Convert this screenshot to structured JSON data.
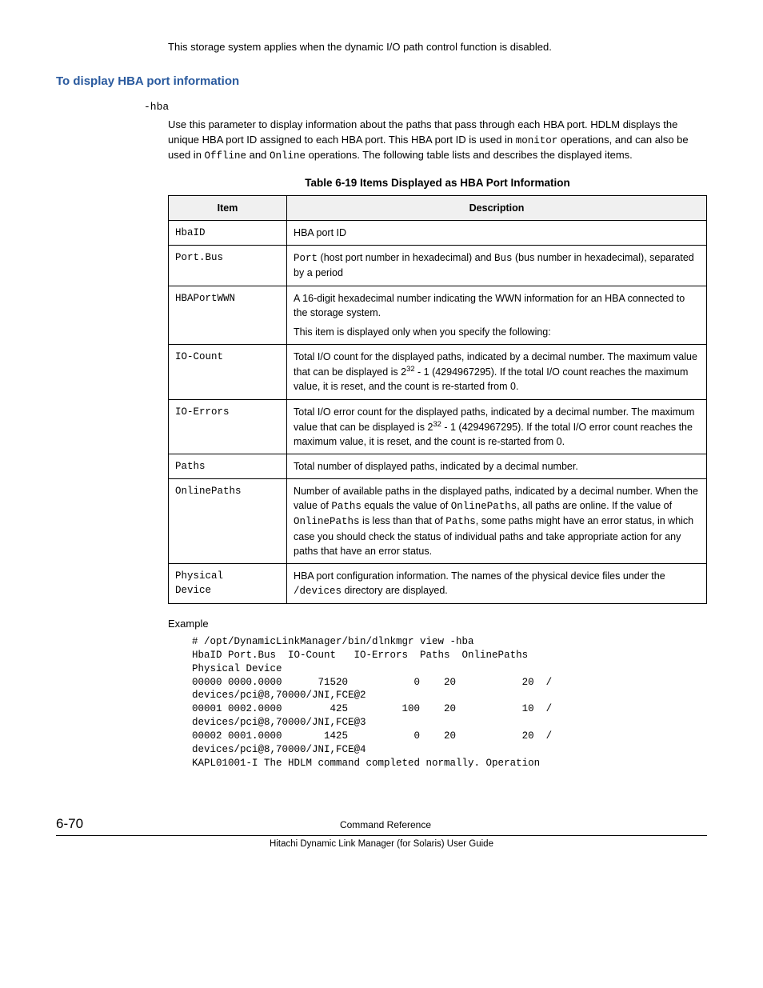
{
  "intro": "This storage system applies when the dynamic I/O path control function is disabled.",
  "heading": "To display HBA port information",
  "param": "-hba",
  "param_desc_1": "Use this parameter to display information about the paths that pass through each HBA port. HDLM displays the unique HBA port ID assigned to each HBA port. This HBA port ID is used in ",
  "param_desc_mono1": "monitor",
  "param_desc_2": " operations, and can also be used in ",
  "param_desc_mono2": "Offline",
  "param_desc_3": " and ",
  "param_desc_mono3": "Online",
  "param_desc_4": " operations. The following table lists and describes the displayed items.",
  "table_caption": "Table 6-19 Items Displayed as HBA Port Information",
  "table_head_item": "Item",
  "table_head_desc": "Description",
  "rows": {
    "r0_item": "HbaID",
    "r0_desc": "HBA port ID",
    "r1_item": "Port.Bus",
    "r1_desc_a": "Port",
    "r1_desc_b": " (host port number in hexadecimal) and ",
    "r1_desc_c": "Bus",
    "r1_desc_d": " (bus number in hexadecimal), separated by a period",
    "r2_item": "HBAPortWWN",
    "r2_desc_a": "A 16-digit hexadecimal number indicating the WWN information for an HBA connected to the storage system.",
    "r2_desc_b": "This item is displayed only when you specify the following:",
    "r3_item": "IO-Count",
    "r3_desc_a": "Total I/O count for the displayed paths, indicated by a decimal number. The maximum value that can be displayed is 2",
    "r3_sup": "32",
    "r3_desc_b": " - 1 (4294967295). If the total I/O count reaches the maximum value, it is reset, and the count is re-started from 0.",
    "r4_item": "IO-Errors",
    "r4_desc_a": "Total I/O error count for the displayed paths, indicated by a decimal number. The maximum value that can be displayed is 2",
    "r4_sup": "32",
    "r4_desc_b": " - 1 (4294967295). If the total I/O error count reaches the maximum value, it is reset, and the count is re-started from 0.",
    "r5_item": "Paths",
    "r5_desc": "Total number of displayed paths, indicated by a decimal number.",
    "r6_item": "OnlinePaths",
    "r6_desc_a": "Number of available paths in the displayed paths, indicated by a decimal number. When the value of ",
    "r6_m1": "Paths",
    "r6_desc_b": " equals the value of ",
    "r6_m2": "OnlinePaths",
    "r6_desc_c": ", all paths are online. If the value of ",
    "r6_m3": "OnlinePaths",
    "r6_desc_d": " is less than that of ",
    "r6_m4": "Paths",
    "r6_desc_e": ", some paths might have an error status, in which case you should check the status of individual paths and take appropriate action for any paths that have an error status.",
    "r7_item_a": "Physical",
    "r7_item_b": "Device",
    "r7_desc_a": "HBA port configuration information. The names of the physical device files under the ",
    "r7_m1": "/devices",
    "r7_desc_b": " directory are displayed."
  },
  "example_label": "Example",
  "example_text": "# /opt/DynamicLinkManager/bin/dlnkmgr view -hba\nHbaID Port.Bus  IO-Count   IO-Errors  Paths  OnlinePaths  \nPhysical Device\n00000 0000.0000      71520           0    20           20  /\ndevices/pci@8,70000/JNI,FCE@2\n00001 0002.0000        425         100    20           10  /\ndevices/pci@8,70000/JNI,FCE@3\n00002 0001.0000       1425           0    20           20  /\ndevices/pci@8,70000/JNI,FCE@4\nKAPL01001-I The HDLM command completed normally. Operation",
  "footer_page": "6-70",
  "footer_center": "Command Reference",
  "footer_bottom": "Hitachi Dynamic Link Manager (for Solaris) User Guide"
}
